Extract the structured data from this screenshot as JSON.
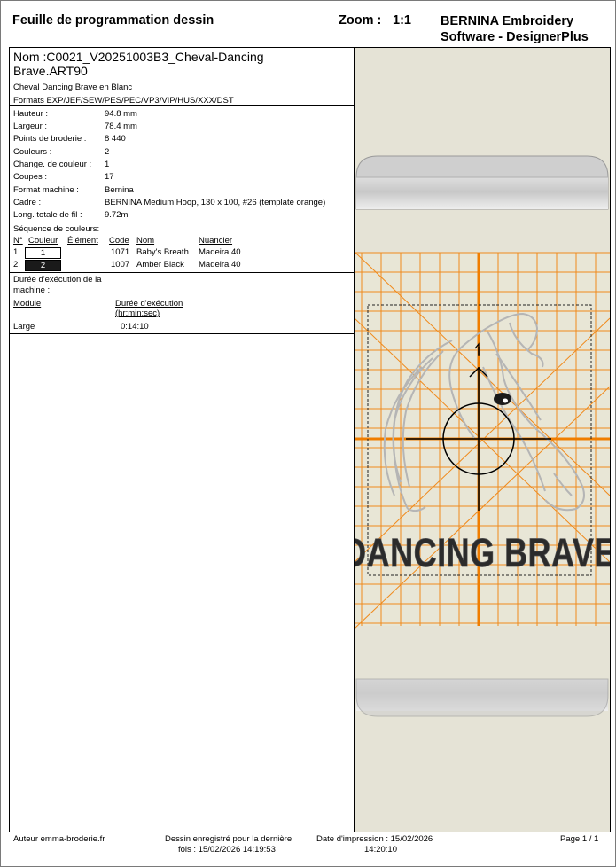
{
  "header": {
    "title": "Feuille de programmation dessin",
    "zoom_label": "Zoom :",
    "zoom_value": "1:1",
    "software_line1": "BERNINA Embroidery",
    "software_line2": "Software - DesignerPlus"
  },
  "design": {
    "name_line1": "Nom  :C0021_V20251003B3_Cheval-Dancing",
    "name_line2": "Brave.ART90",
    "description": "Cheval Dancing Brave en Blanc",
    "formats": "Formats EXP/JEF/SEW/PES/PEC/VP3/VIP/HUS/XXX/DST"
  },
  "properties": [
    {
      "label": "Hauteur :",
      "value": "94.8 mm"
    },
    {
      "label": "Largeur :",
      "value": "78.4 mm"
    },
    {
      "label": "Points de broderie :",
      "value": "8 440"
    },
    {
      "label": "Couleurs :",
      "value": "2"
    },
    {
      "label": "Change. de couleur :",
      "value": "1"
    },
    {
      "label": "Coupes :",
      "value": "17"
    },
    {
      "label": "Format machine :",
      "value": "Bernina"
    },
    {
      "label": "Cadre :",
      "value": "BERNINA Medium Hoop, 130 x 100, #26 (template orange)"
    },
    {
      "label": "Long. totale de fil :",
      "value": "9.72m"
    }
  ],
  "color_sequence": {
    "title": "Séquence de couleurs:",
    "headers": {
      "num": "N°",
      "color": "Couleur",
      "element": "Élément",
      "code": "Code",
      "name": "Nom",
      "chart": "Nuancier"
    },
    "rows": [
      {
        "index": "1.",
        "swatch": "1",
        "swatch_bg": "#ffffff",
        "swatch_fg": "#000000",
        "code": "1071",
        "name": "Baby's Breath",
        "chart": "Madeira 40"
      },
      {
        "index": "2.",
        "swatch": "2",
        "swatch_bg": "#1a1a1a",
        "swatch_fg": "#ffffff",
        "code": "1007",
        "name": "Amber Black",
        "chart": "Madeira 40"
      }
    ]
  },
  "runtime": {
    "title_line1": "Durée d'exécution de la",
    "title_line2": "machine :",
    "col_module": "Module",
    "col_duration_line1": "Durée d'exécution",
    "col_duration_line2": "(hr:min:sec)",
    "rows": [
      {
        "module": "Large",
        "duration": "0:14:10"
      }
    ]
  },
  "preview": {
    "design_text": "DANCING BRAVE",
    "fabric_color": "#e5e3d6",
    "grid_color": "#f08a1c",
    "axis_color": "#f07d00",
    "thread_white": "#ffffff",
    "thread_black": "#1a1a1a"
  },
  "footer": {
    "author": "Auteur emma-broderie.fr",
    "saved_line1": "Dessin enregistré pour la dernière",
    "saved_line2": "fois : 15/02/2026 14:19:53",
    "print_line1": "Date d'impression : 15/02/2026",
    "print_line2": "14:20:10",
    "page": "Page 1 / 1"
  }
}
